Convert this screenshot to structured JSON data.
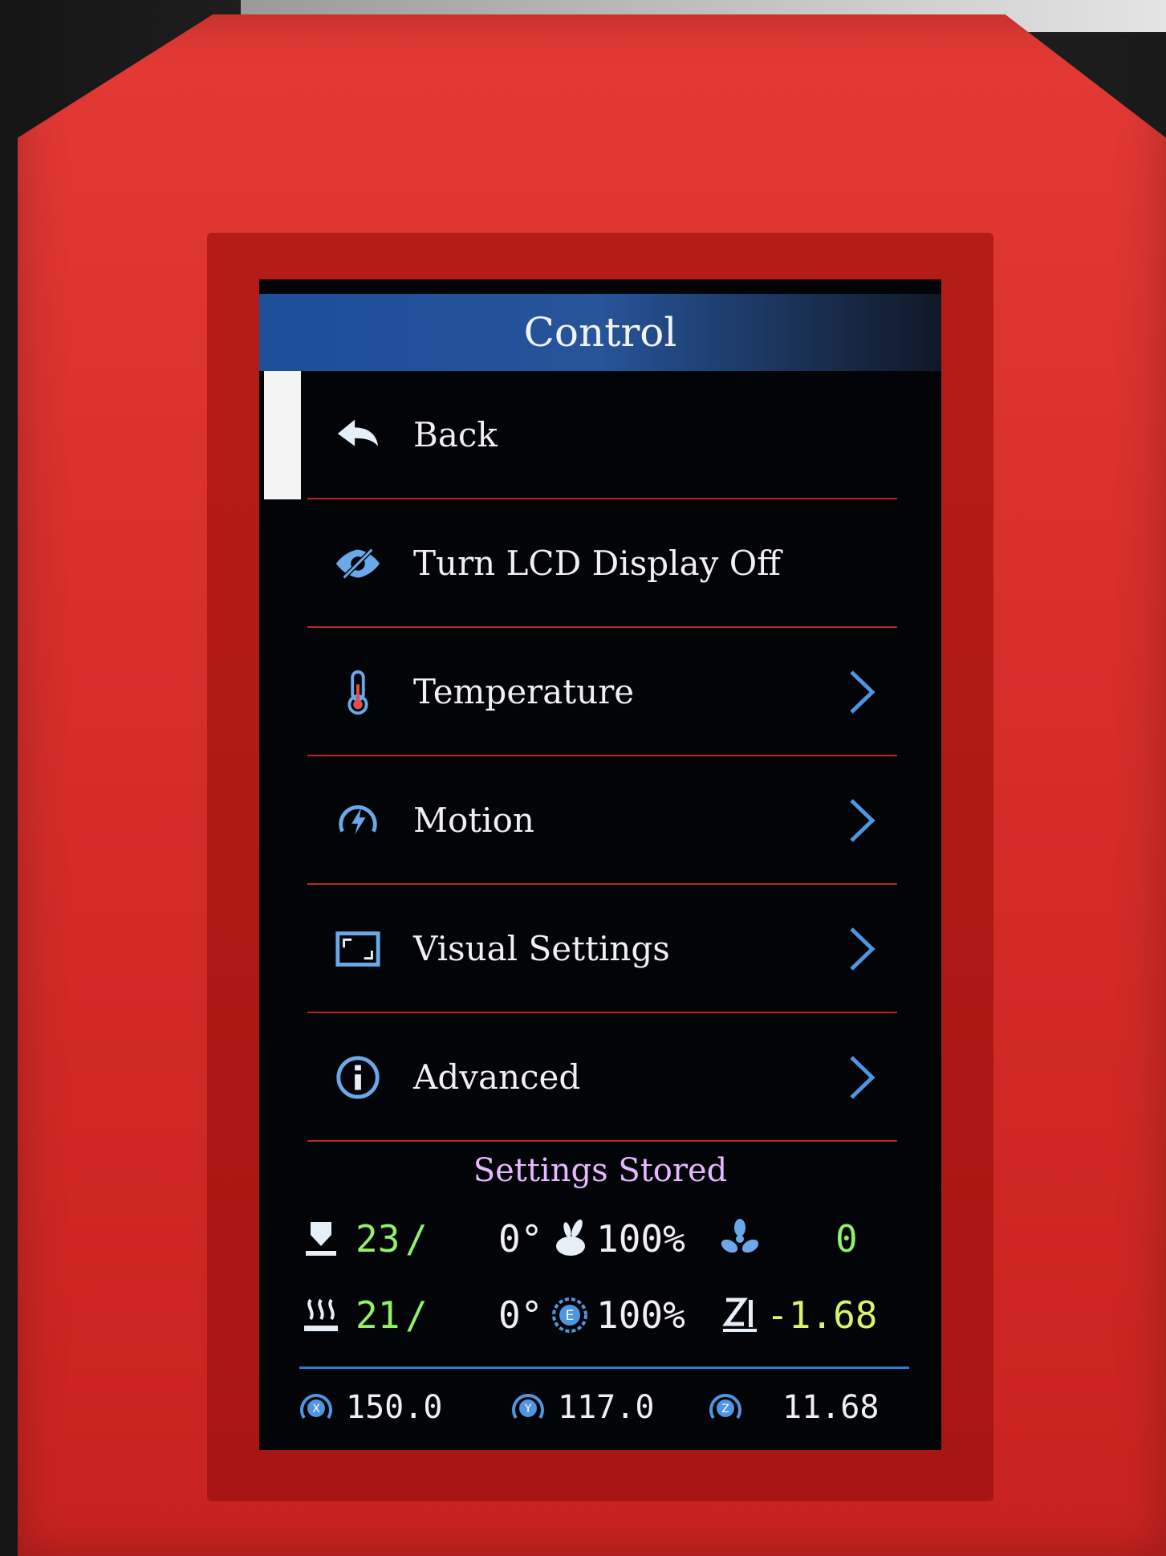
{
  "screen": {
    "title": "Control",
    "menu": [
      {
        "label": "Back",
        "icon": "back-arrow-icon",
        "submenu": false,
        "selected": true
      },
      {
        "label": "Turn LCD Display Off",
        "icon": "eye-slash-icon",
        "submenu": false,
        "selected": false
      },
      {
        "label": "Temperature",
        "icon": "thermometer-icon",
        "submenu": true,
        "selected": false
      },
      {
        "label": "Motion",
        "icon": "motion-icon",
        "submenu": true,
        "selected": false
      },
      {
        "label": "Visual Settings",
        "icon": "display-icon",
        "submenu": true,
        "selected": false
      },
      {
        "label": "Advanced",
        "icon": "info-icon",
        "submenu": true,
        "selected": false
      }
    ],
    "status_message": "Settings Stored",
    "stats": {
      "hotend_current": "23",
      "hotend_target": "0°",
      "feedrate": "100%",
      "fan": "0",
      "bed_current": "21",
      "bed_target": "0°",
      "flow": "100%",
      "z_offset": "-1.68"
    },
    "axes": {
      "x": "150.0",
      "y": "117.0",
      "z": "11.68"
    },
    "colors": {
      "header_blue": "#1c4e9a",
      "divider_red": "#b8261e",
      "accent_blue": "#6aa8e8",
      "temp_green": "#92f06a",
      "status_purple": "#e7b7ff",
      "case_red": "#d8302b"
    }
  }
}
